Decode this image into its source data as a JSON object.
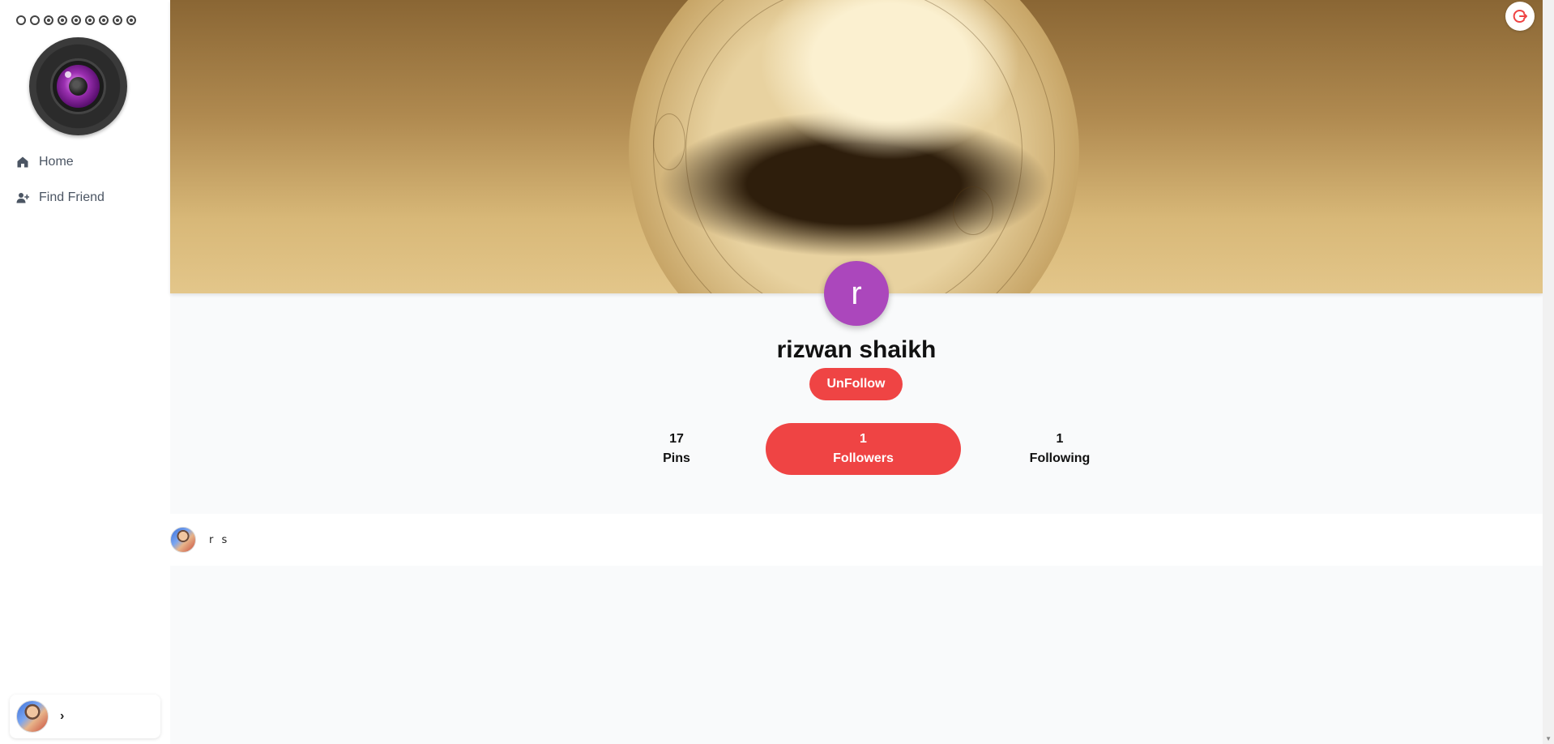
{
  "sidebar": {
    "nav": [
      {
        "label": "Home",
        "icon": "home-icon"
      },
      {
        "label": "Find Friend",
        "icon": "user-plus-icon"
      }
    ],
    "user_card_icon": "chevron-right-icon",
    "user_card_chevron": "›"
  },
  "cover": {
    "logout_icon": "logout-icon",
    "logout_color": "#ef4444"
  },
  "profile": {
    "initial": "r",
    "name": "rizwan shaikh",
    "action_label": "UnFollow",
    "avatar_color": "#ab47bc",
    "accent": "#ef4444",
    "stats": [
      {
        "value": "17",
        "label": "Pins"
      },
      {
        "value": "1",
        "label": "Followers"
      },
      {
        "value": "1",
        "label": "Following"
      }
    ]
  },
  "followers_list": [
    {
      "name": "r s"
    }
  ]
}
